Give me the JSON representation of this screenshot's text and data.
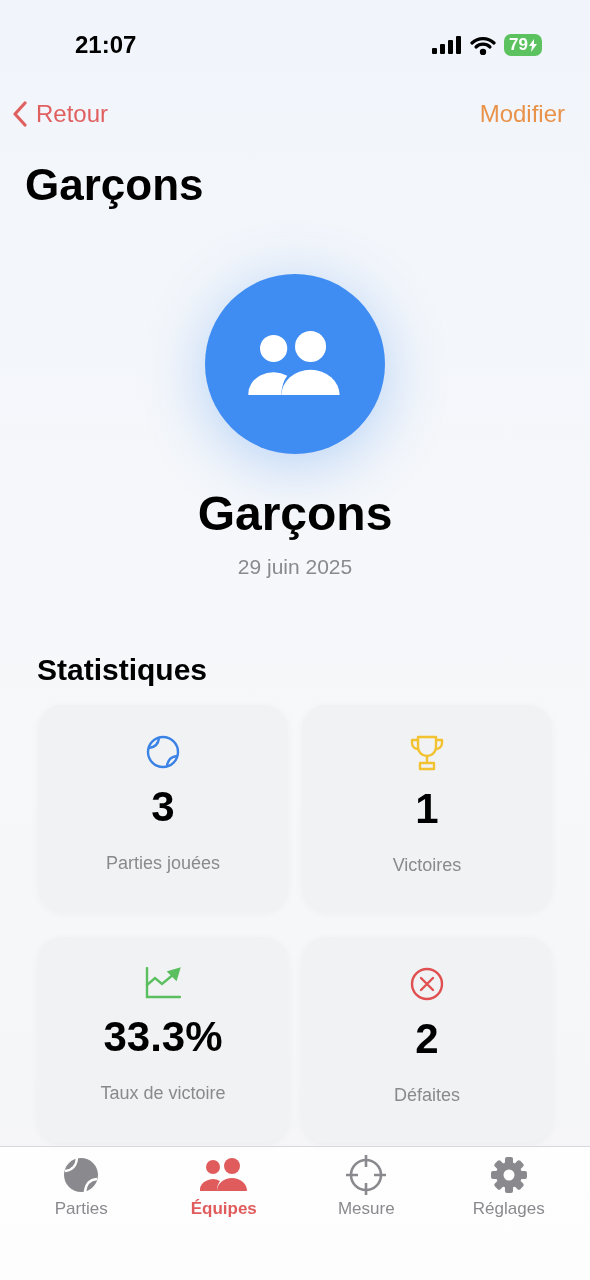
{
  "status_bar": {
    "time": "21:07",
    "battery": "79"
  },
  "nav": {
    "back": "Retour",
    "action": "Modifier"
  },
  "title": "Garçons",
  "team": {
    "name": "Garçons",
    "date": "29 juin 2025"
  },
  "stats_title": "Statistiques",
  "stats": [
    {
      "value": "3",
      "label": "Parties jouées"
    },
    {
      "value": "1",
      "label": "Victoires"
    },
    {
      "value": "33.3%",
      "label": "Taux de victoire"
    },
    {
      "value": "2",
      "label": "Défaites"
    }
  ],
  "tabs": [
    {
      "label": "Parties",
      "selected": false
    },
    {
      "label": "Équipes",
      "selected": true
    },
    {
      "label": "Mesure",
      "selected": false
    },
    {
      "label": "Réglages",
      "selected": false
    }
  ]
}
